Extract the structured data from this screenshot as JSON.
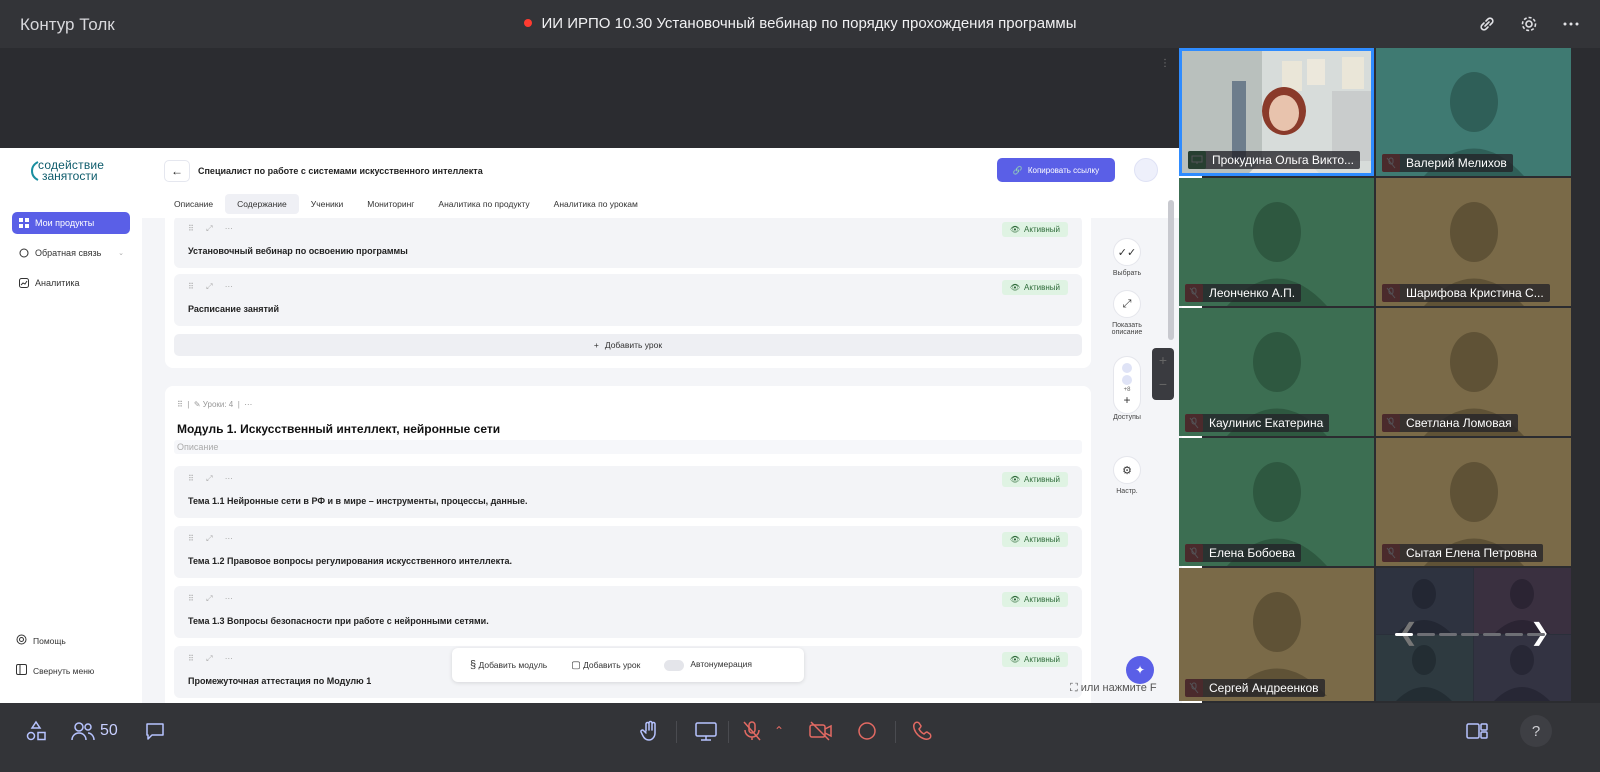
{
  "app": {
    "name": "Контур Толк",
    "meeting_title": "ИИ ИРПО 10.30 Установочный вебинар по порядку прохождения программы"
  },
  "shared": {
    "logo": {
      "line1": "содействие",
      "line2": "занятости"
    },
    "sidebar": {
      "items": [
        {
          "label": "Мои продукты",
          "icon": "grid-icon"
        },
        {
          "label": "Обратная связь",
          "icon": "chat-icon"
        },
        {
          "label": "Аналитика",
          "icon": "chart-icon"
        }
      ],
      "help": "Помощь",
      "collapse": "Свернуть меню"
    },
    "header": {
      "course_title": "Специалист по работе с системами искусственного интеллекта",
      "copy_link": "Копировать ссылку",
      "tabs": [
        "Описание",
        "Содержание",
        "Ученики",
        "Мониторинг",
        "Аналитика по продукту",
        "Аналитика по урокам"
      ],
      "active_tab": "Содержание"
    },
    "status_label": "Активный",
    "top_lessons": [
      {
        "title": "Установочный вебинар по освоению программы"
      },
      {
        "title": "Расписание занятий"
      }
    ],
    "add_lesson": "Добавить урок",
    "module": {
      "meta": "Уроки: 4",
      "title": "Модуль 1. Искусственный интеллект, нейронные сети",
      "description_placeholder": "Описание",
      "lessons": [
        {
          "title": "Тема 1.1 Нейронные сети в РФ и в мире – инструменты, процессы, данные."
        },
        {
          "title": "Тема 1.2 Правовое вопросы регулирования искусственного интеллекта."
        },
        {
          "title": "Тема 1.3 Вопросы безопасности при работе с нейронными сетями."
        },
        {
          "title": "Промежуточная аттестация по Модулю 1"
        }
      ]
    },
    "right_tools": {
      "select": "Выбрать",
      "show_desc_1": "Показать",
      "show_desc_2": "описание",
      "access": "Доступы",
      "access_count": "+8",
      "settings": "Настр."
    },
    "bottom_toolbar": {
      "add_module": "Добавить модуль",
      "add_lesson": "Добавить урок",
      "autonumber": "Автонумерация"
    }
  },
  "fullscreen_hint": "или нажмите F",
  "participants": [
    {
      "name": "Прокудина Ольга Викто...",
      "video": true,
      "mic": "on"
    },
    {
      "name": "Валерий Мелихов",
      "bg": "#3f7a72",
      "mic": "off"
    },
    {
      "name": "Леонченко А.П.",
      "bg": "#3c6e52",
      "mic": "off"
    },
    {
      "name": "Шарифова Кристина С...",
      "bg": "#7a6a48",
      "mic": "off"
    },
    {
      "name": "Каулинис Екатерина",
      "bg": "#3c6e52",
      "mic": "off"
    },
    {
      "name": "Светлана Ломовая",
      "bg": "#7a6a48",
      "mic": "off"
    },
    {
      "name": "Елена Бобоева",
      "bg": "#3c6e52",
      "mic": "off"
    },
    {
      "name": "Сытая Елена Петровна",
      "bg": "#7a6a48",
      "mic": "off"
    },
    {
      "name": "Сергей Андреенков",
      "bg": "#7a6a48",
      "mic": "off"
    }
  ],
  "controls": {
    "participants_count": "50"
  },
  "colors": {
    "accent": "#5a5fe7",
    "active_badge": "#dff3e3",
    "mic_off": "#d6453d",
    "mic_on": "#3aa655"
  }
}
